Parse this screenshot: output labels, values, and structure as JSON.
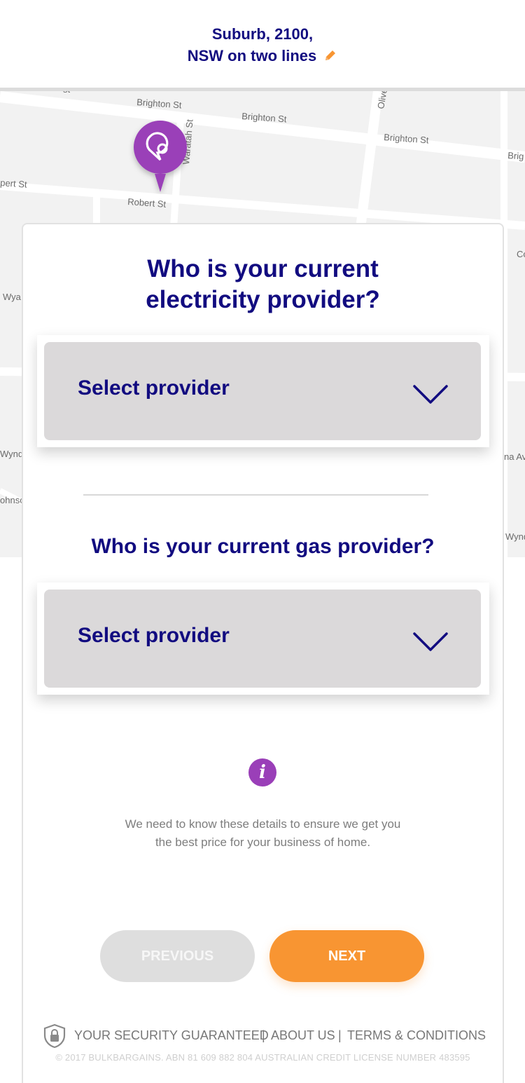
{
  "header": {
    "address_line1": "Suburb, 2100,",
    "address_line2": "NSW on two lines",
    "edit_icon": "pencil-icon"
  },
  "map": {
    "streets": [
      "Brighton St",
      "Brighton St",
      "Brighton St",
      "Brig",
      "Waratah St",
      "Olive",
      "Robert St",
      "pert St",
      "Wya",
      "Wyndo",
      "ohnso",
      "na Av",
      "Wynd",
      "Co",
      "st"
    ],
    "pin_icon": "location-pin-icon"
  },
  "electricity": {
    "question": "Who is your current electricity provider?",
    "question_line1": "Who is your current",
    "question_line2": "electricity provider?",
    "select_label": "Select provider"
  },
  "gas": {
    "question": "Who is your current gas provider?",
    "select_label": "Select provider"
  },
  "info": {
    "icon_glyph": "i",
    "line1": "We need to know these details to ensure we get you",
    "line2": "the best price for your business of home."
  },
  "buttons": {
    "previous": "PREVIOUS",
    "next": "NEXT"
  },
  "footer": {
    "security": "YOUR SECURITY GUARANTEED",
    "about": "ABOUT US",
    "terms": "TERMS & CONDITIONS",
    "separator": "|",
    "copyright": "© 2017 BULKBARGAINS. ABN 81 609 882 804 AUSTRALIAN CREDIT LICENSE NUMBER 483595"
  },
  "colors": {
    "brand_navy": "#120c80",
    "accent_orange": "#f89532",
    "accent_purple": "#9a3fb8",
    "select_bg": "#dbd9da"
  }
}
